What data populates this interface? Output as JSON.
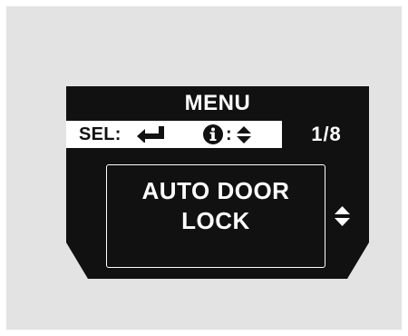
{
  "display": {
    "title": "MENU",
    "status_bar": {
      "select_label": "SEL:",
      "select_icon": "enter-icon",
      "info_icon": "info-icon",
      "info_colon": ":",
      "scroll_icon": "up-down-arrows-icon",
      "page_indicator": "1/8"
    },
    "menu_item": {
      "line1": "AUTO DOOR",
      "line2": "LOCK"
    },
    "side_icon": "up-down-arrows-icon"
  },
  "colors": {
    "frame_background": "#e3e3e3",
    "display_background": "#111111",
    "text_primary": "#ffffff",
    "status_bar_background": "#ffffff"
  }
}
